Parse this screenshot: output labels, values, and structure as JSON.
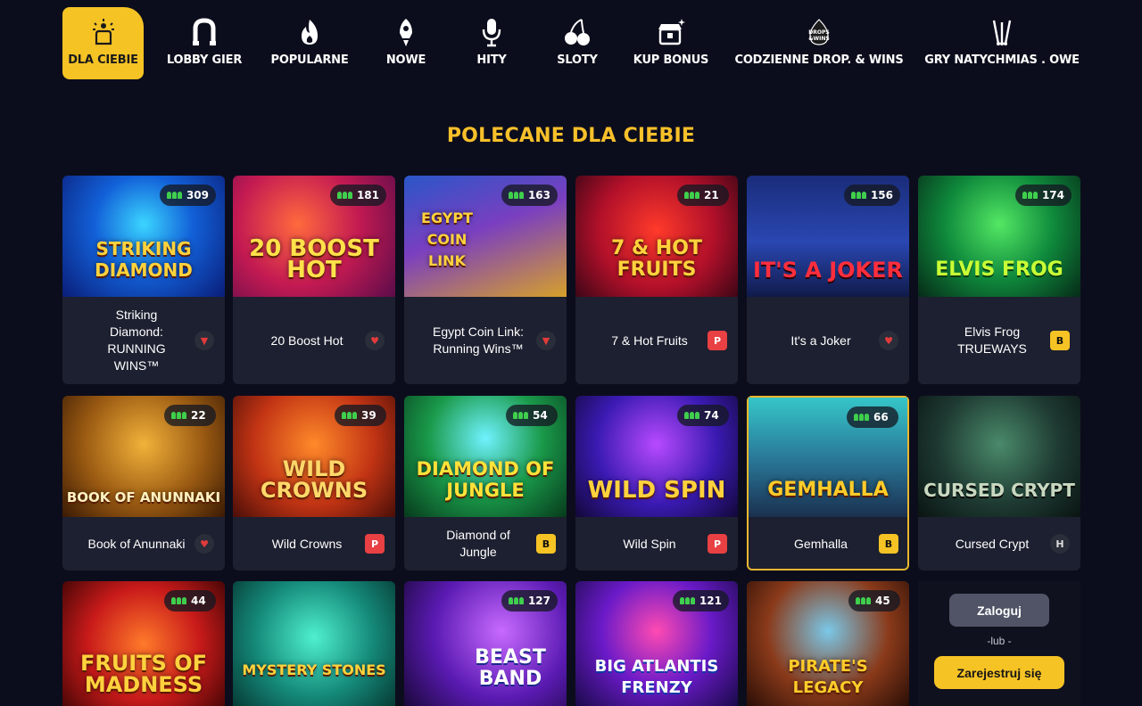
{
  "nav": {
    "items": [
      {
        "label": "DLA CIEBIE",
        "icon": "sparkle-hand-icon",
        "active": true
      },
      {
        "label": "LOBBY GIER",
        "icon": "horseshoe-icon"
      },
      {
        "label": "POPULARNE",
        "icon": "fire-icon"
      },
      {
        "label": "NOWE",
        "icon": "rocket-icon"
      },
      {
        "label": "HITY",
        "icon": "microphone-icon"
      },
      {
        "label": "SLOTY",
        "icon": "cherries-icon"
      },
      {
        "label": "KUP BONUS",
        "icon": "bonus-chest-icon"
      },
      {
        "label": "CODZIENNE DROP. & WINS",
        "icon": "drops-wins-icon"
      },
      {
        "label": "GRY NATYCHMIAS . OWE",
        "icon": "dart-icon"
      }
    ]
  },
  "section": {
    "title": "POLECANE DLA CIEBIE"
  },
  "games": [
    {
      "name": "Striking Diamond: RUNNING WINS™",
      "art": "STRIKING DIAMOND",
      "players": "309",
      "provider": "dark",
      "provider_icon": "▼"
    },
    {
      "name": "20 Boost Hot",
      "art": "20 BOOST HOT",
      "players": "181",
      "provider": "dark",
      "provider_icon": "♥"
    },
    {
      "name": "Egypt Coin Link: Running Wins™",
      "art": "EGYPT COIN LINK",
      "players": "163",
      "provider": "dark",
      "provider_icon": "▼"
    },
    {
      "name": "7 & Hot Fruits",
      "art": "7 & HOT FRUITS",
      "players": "21",
      "provider": "p",
      "provider_icon": "P"
    },
    {
      "name": "It's a Joker",
      "art": "IT'S A JOKER",
      "players": "156",
      "provider": "dark",
      "provider_icon": "♥"
    },
    {
      "name": "Elvis Frog TRUEWAYS",
      "art": "ELVIS FROG",
      "players": "174",
      "provider": "b",
      "provider_icon": "B"
    },
    {
      "name": "Book of Anunnaki",
      "art": "BOOK OF ANUNNAKI",
      "players": "22",
      "provider": "dark",
      "provider_icon": "♥"
    },
    {
      "name": "Wild Crowns",
      "art": "WILD CROWNS",
      "players": "39",
      "provider": "p",
      "provider_icon": "P"
    },
    {
      "name": "Diamond of Jungle",
      "art": "DIAMOND OF JUNGLE",
      "players": "54",
      "provider": "b",
      "provider_icon": "B"
    },
    {
      "name": "Wild Spin",
      "art": "WILD SPIN",
      "players": "74",
      "provider": "p",
      "provider_icon": "P"
    },
    {
      "name": "Gemhalla",
      "art": "GEMHALLA",
      "players": "66",
      "provider": "b",
      "provider_icon": "B"
    },
    {
      "name": "Cursed Crypt",
      "art": "CURSED CRYPT",
      "players": "",
      "provider": "h",
      "provider_icon": "H"
    },
    {
      "name": "",
      "art": "FRUITS OF MADNESS",
      "players": "44"
    },
    {
      "name": "",
      "art": "MYSTERY STONES",
      "players": ""
    },
    {
      "name": "",
      "art": "BEAST BAND",
      "players": "127"
    },
    {
      "name": "",
      "art": "BIG ATLANTIS FRENZY",
      "players": "121"
    },
    {
      "name": "",
      "art": "PIRATE'S LEGACY",
      "players": "45"
    }
  ],
  "auth": {
    "login_label": "Zaloguj",
    "or_label": "-lub -",
    "register_label": "Zarejestruj się"
  }
}
